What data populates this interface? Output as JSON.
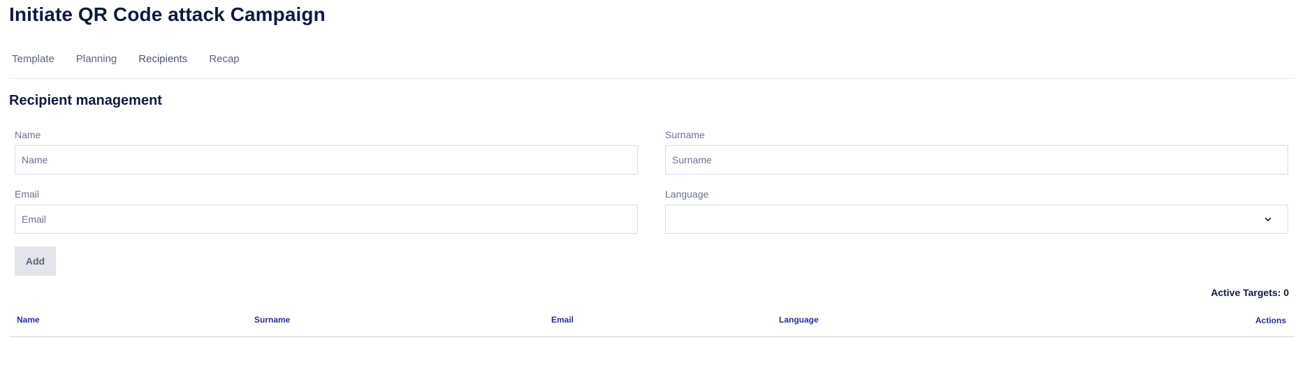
{
  "page": {
    "title": "Initiate QR Code attack Campaign"
  },
  "tabs": [
    {
      "label": "Template"
    },
    {
      "label": "Planning"
    },
    {
      "label": "Recipients"
    },
    {
      "label": "Recap"
    }
  ],
  "section": {
    "title": "Recipient management"
  },
  "form": {
    "name": {
      "label": "Name",
      "placeholder": "Name",
      "value": ""
    },
    "surname": {
      "label": "Surname",
      "placeholder": "Surname",
      "value": ""
    },
    "email": {
      "label": "Email",
      "placeholder": "Email",
      "value": ""
    },
    "language": {
      "label": "Language",
      "selected": ""
    },
    "add_label": "Add"
  },
  "summary": {
    "active_targets": "Active Targets: 0"
  },
  "table": {
    "headers": [
      "Name",
      "Surname",
      "Email",
      "Language",
      "Actions"
    ]
  },
  "icons": {
    "language_dropdown": "chevron-down-icon"
  },
  "colors": {
    "title": "#101a3f",
    "table_header": "#2a2f8f",
    "button_bg": "#e3e5ea"
  }
}
